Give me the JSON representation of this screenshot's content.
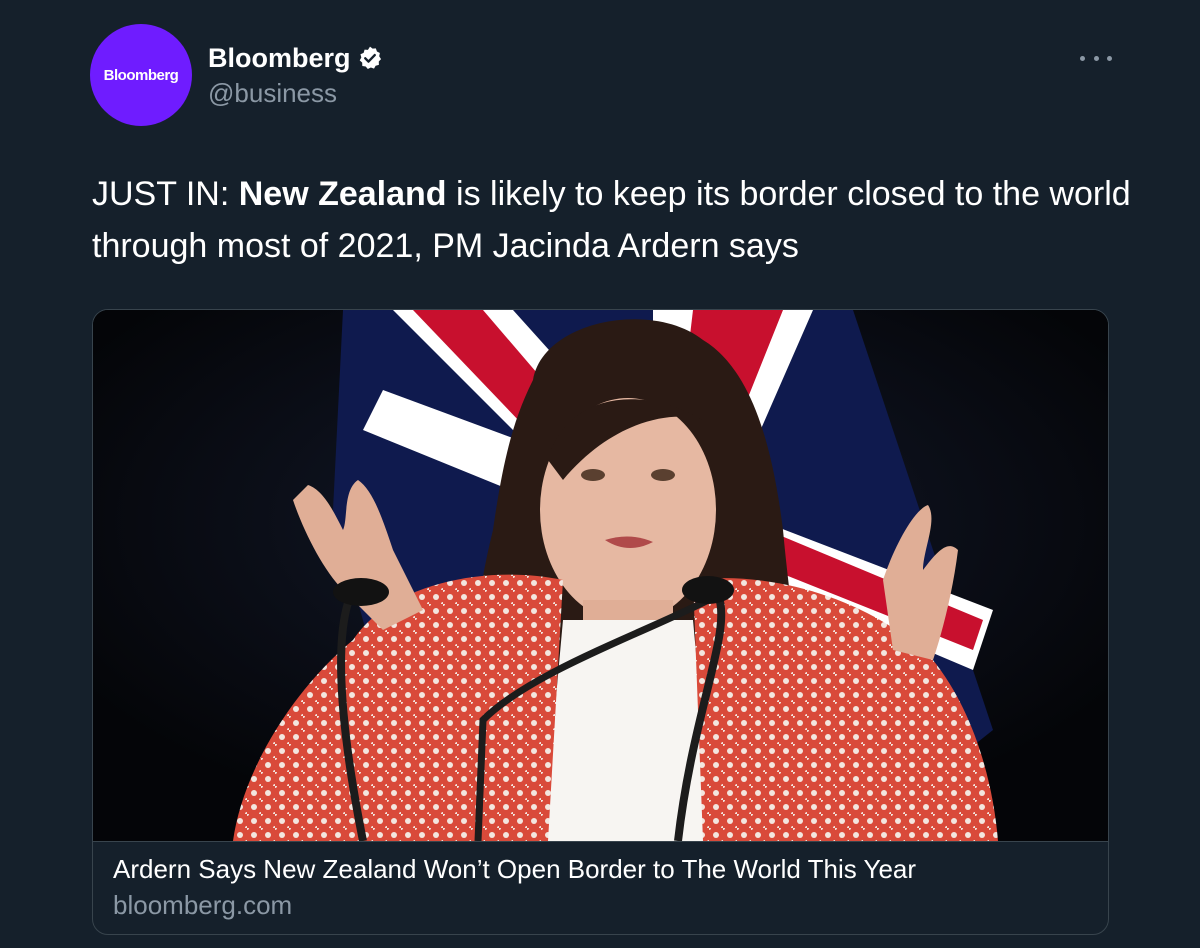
{
  "account": {
    "avatar_text": "Bloomberg",
    "display_name": "Bloomberg",
    "handle": "@business",
    "verified_icon": "verified-badge-icon",
    "avatar_color": "#6f1cff"
  },
  "menu": {
    "more_icon": "more-horizontal-icon"
  },
  "tweet": {
    "text_prefix": "JUST IN: ",
    "text_bold": "New Zealand",
    "text_rest": " is likely to keep its border closed to the world through most of 2021, PM Jacinda Ardern says"
  },
  "card": {
    "image_description_icon": "photo",
    "title": "Ardern Says New Zealand Won’t Open Border to The World This Year",
    "domain": "bloomberg.com"
  },
  "colors": {
    "background": "#15202b",
    "secondary_text": "#8b98a5",
    "border": "#38444d"
  }
}
